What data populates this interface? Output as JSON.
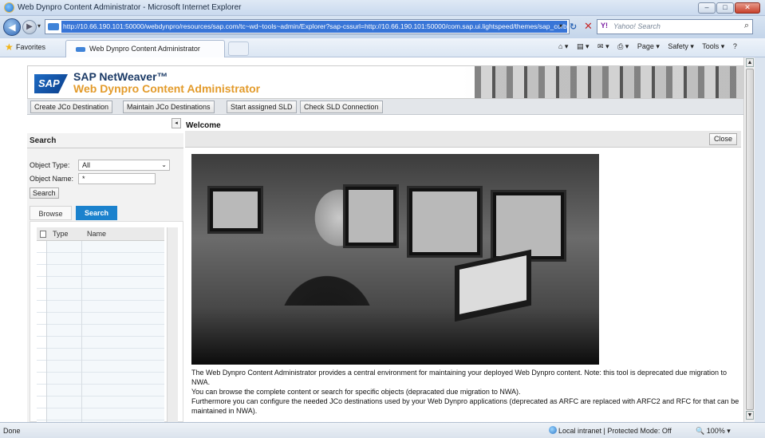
{
  "browser": {
    "window_title": "Web Dynpro Content Administrator - Microsoft Internet Explorer",
    "url": "http://10.66.190.101:50000/webdynpro/resources/sap.com/tc~wd~tools~admin/Explorer?sap-cssurl=http://10.66.190.101:50000/com.sap.ui.lightspeed/themes/sap_corbu",
    "search_placeholder": "Yahoo! Search",
    "favorites_label": "Favorites",
    "tab_title": "Web Dynpro Content Administrator",
    "command_items": [
      "Page ▾",
      "Safety ▾",
      "Tools ▾",
      "?"
    ],
    "status_left": "Done",
    "status_zone": "Local intranet | Protected Mode: Off",
    "zoom": "100%"
  },
  "app": {
    "brand": "SAP",
    "product": "SAP NetWeaver™",
    "title": "Web Dynpro Content Administrator"
  },
  "toolbar": {
    "buttons": [
      "Create JCo Destination",
      "Maintain JCo Destinations",
      "Start assigned SLD",
      "Check SLD Connection"
    ]
  },
  "search_panel": {
    "title": "Search",
    "object_type_label": "Object Type:",
    "object_type_value": "All",
    "object_name_label": "Object Name:",
    "object_name_value": "*",
    "search_button": "Search",
    "tabs": [
      "Browse",
      "Search"
    ],
    "columns": [
      "Type",
      "Name"
    ]
  },
  "welcome": {
    "title": "Welcome",
    "close_button": "Close",
    "paragraphs": [
      "The Web Dynpro Content Administrator provides a central environment for maintaining your deployed Web Dynpro content. Note: this tool is deprecated due migration to NWA.",
      "You can browse the complete content or search for specific objects (depracated due migration to NWA).",
      "Furthermore you can configure the needed JCo destinations used by your Web Dynpro applications (deprecated as ARFC are replaced with ARFC2 and RFC for that can be maintained in NWA)."
    ]
  },
  "colors": {
    "accent_blue": "#1b82cd",
    "brand_orange": "#e39b2b",
    "brand_navy": "#1b3a66"
  }
}
